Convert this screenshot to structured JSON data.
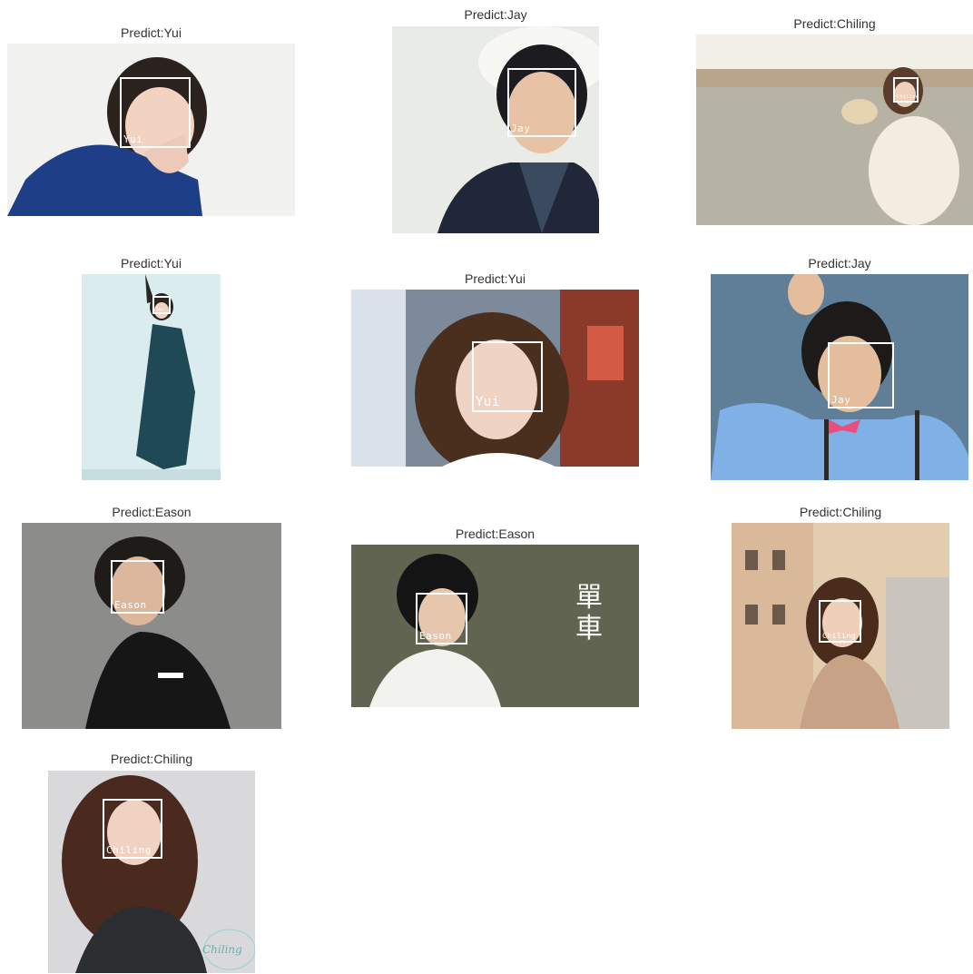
{
  "panels": [
    {
      "title": "Predict:Yui",
      "face_label": "Yui"
    },
    {
      "title": "Predict:Jay",
      "face_label": "Jay"
    },
    {
      "title": "Predict:Chiling",
      "face_label": "Chiling"
    },
    {
      "title": "Predict:Yui",
      "face_label": "Yui"
    },
    {
      "title": "Predict:Yui",
      "face_label": "Yui"
    },
    {
      "title": "Predict:Jay",
      "face_label": "Jay"
    },
    {
      "title": "Predict:Eason",
      "face_label": "Eason"
    },
    {
      "title": "Predict:Eason",
      "face_label": "Eason"
    },
    {
      "title": "Predict:Chiling",
      "face_label": "Chiling"
    },
    {
      "title": "Predict:Chiling",
      "face_label": "Chiling"
    }
  ],
  "extras": {
    "poster_chars": [
      "單",
      "車"
    ],
    "signature": "Chiling"
  },
  "colors": {
    "box": "#ffffff",
    "title_text": "#333333"
  }
}
